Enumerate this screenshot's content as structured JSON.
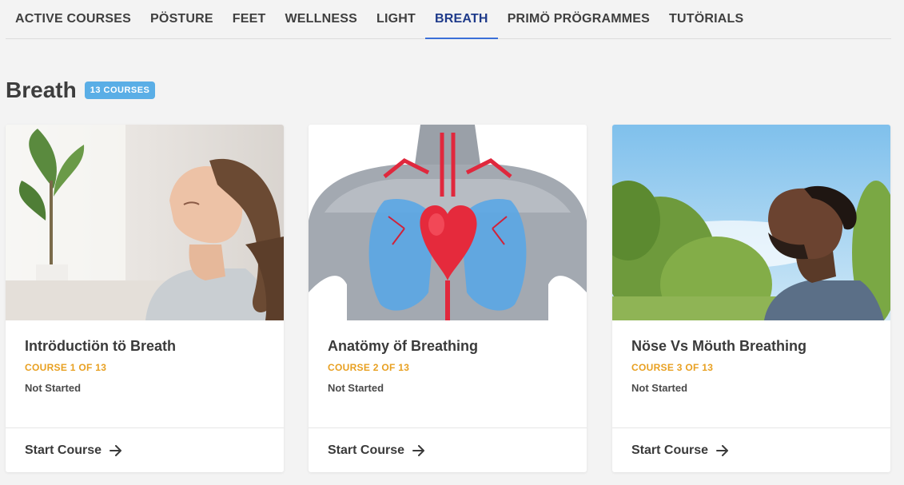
{
  "nav": {
    "tabs": [
      {
        "label": "ACTIVE COURSES"
      },
      {
        "label": "PÖSTURE"
      },
      {
        "label": "FEET"
      },
      {
        "label": "WELLNESS"
      },
      {
        "label": "LIGHT"
      },
      {
        "label": "BREATH",
        "active": true
      },
      {
        "label": "PRIMÖ PRÖGRAMMES"
      },
      {
        "label": "TUTÖRIALS"
      }
    ]
  },
  "section": {
    "title": "Breath",
    "badge": "13 COURSES"
  },
  "colors": {
    "accent": "#3b6fd8",
    "badge": "#5aaee6",
    "course_meta": "#e8a021"
  },
  "cards": [
    {
      "title": "Intröductiön tö Breath",
      "meta": "COURSE 1 OF 13",
      "status": "Not Started",
      "action": "Start Course",
      "image": "woman-breathing-photo"
    },
    {
      "title": "Anatömy öf Breathing",
      "meta": "COURSE 2 OF 13",
      "status": "Not Started",
      "action": "Start Course",
      "image": "heart-lungs-anatomy-illustration"
    },
    {
      "title": "Nöse Vs Möuth Breathing",
      "meta": "COURSE 3 OF 13",
      "status": "Not Started",
      "action": "Start Course",
      "image": "man-breathing-outdoors-photo"
    }
  ]
}
